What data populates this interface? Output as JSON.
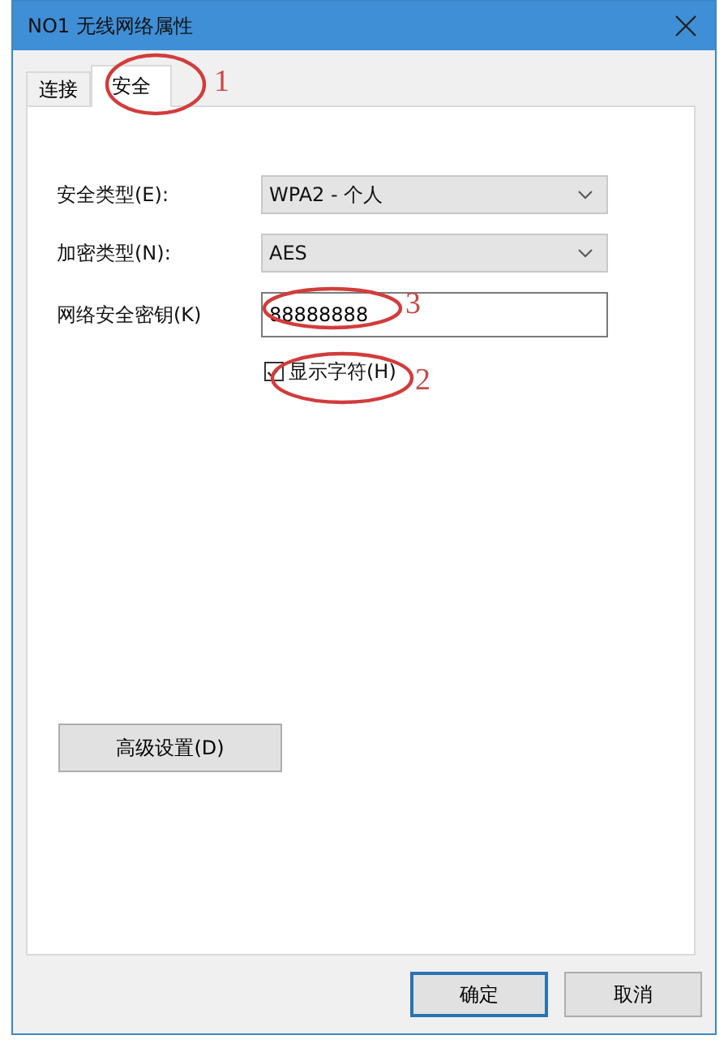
{
  "window": {
    "title": "NO1 无线网络属性"
  },
  "tabs": [
    {
      "label": "连接",
      "selected": false
    },
    {
      "label": "安全",
      "selected": true
    }
  ],
  "fields": [
    {
      "kind": "dropdown",
      "label": "安全类型(E):",
      "value": "WPA2 - 个人"
    },
    {
      "kind": "dropdown",
      "label": "加密类型(N):",
      "value": "AES"
    },
    {
      "kind": "text",
      "label": "网络安全密钥(K)",
      "value": "88888888"
    }
  ],
  "show_characters": {
    "label": "显示字符(H)",
    "checked": true
  },
  "advanced_button": "高级设置(D)",
  "buttons": [
    {
      "label": "确定",
      "default": true
    },
    {
      "label": "取消",
      "default": false
    }
  ],
  "annotations": [
    {
      "number": "1"
    },
    {
      "number": "3"
    },
    {
      "number": "2"
    }
  ]
}
